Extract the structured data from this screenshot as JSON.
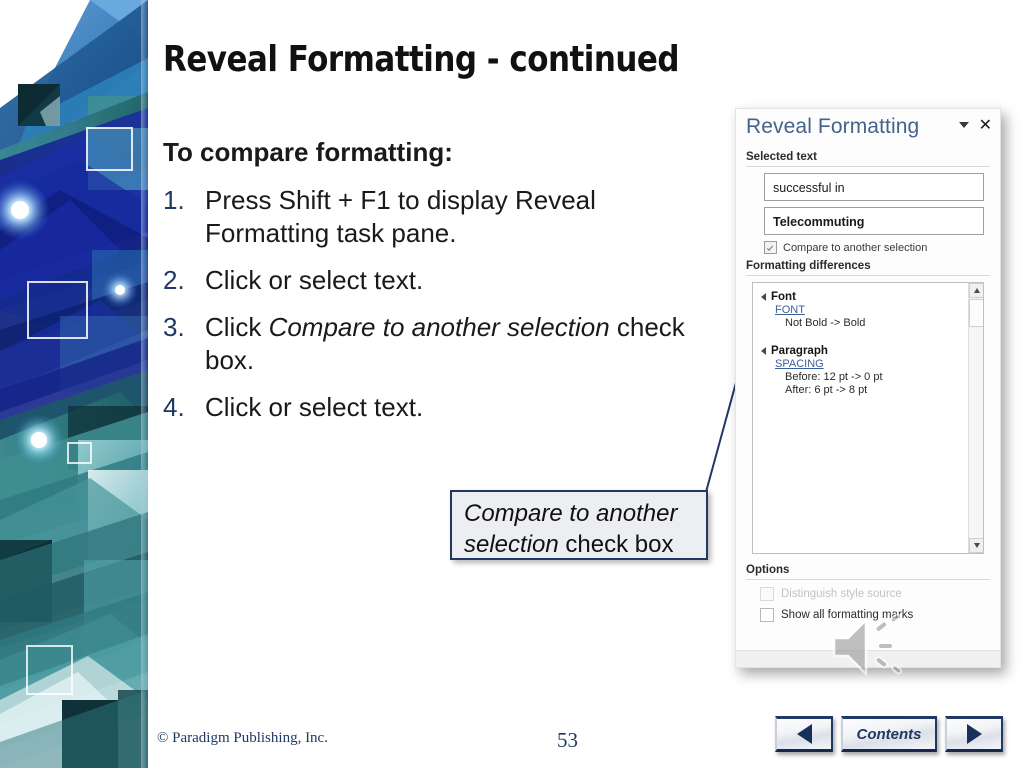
{
  "slide": {
    "title": "Reveal Formatting - continued",
    "lead": "To compare formatting:",
    "steps": [
      {
        "num": "1.",
        "pre": "Press Shift + F1 to display Reveal Formatting task pane.",
        "italic": "",
        "post": ""
      },
      {
        "num": "2.",
        "pre": "Click or select text.",
        "italic": "",
        "post": ""
      },
      {
        "num": "3.",
        "pre": "Click ",
        "italic": "Compare to another selection",
        "post": " check box."
      },
      {
        "num": "4.",
        "pre": "Click or select text.",
        "italic": "",
        "post": ""
      }
    ]
  },
  "callout": {
    "italic": "Compare to another selection",
    "post": " check box"
  },
  "pane": {
    "title": "Reveal Formatting",
    "collapse_icon": "chevron-down-icon",
    "close_icon": "close-icon",
    "selected_text_label": "Selected text",
    "selected_boxes": [
      {
        "value": "successful in",
        "bold": false
      },
      {
        "value": "Telecommuting",
        "bold": true
      }
    ],
    "compare_checkbox": {
      "label": "Compare to another selection",
      "checked": true
    },
    "differences_label": "Formatting differences",
    "differences": [
      {
        "group": "Font",
        "link": "FONT",
        "values": [
          "Not Bold -> Bold"
        ]
      },
      {
        "group": "Paragraph",
        "link": "SPACING",
        "values": [
          "Before:  12 pt ->  0 pt",
          "After:  6 pt ->  8 pt"
        ]
      }
    ],
    "scrollbar": {
      "up_icon": "scroll-up-arrow-icon",
      "down_icon": "scroll-down-arrow-icon"
    },
    "options_label": "Options",
    "options": [
      {
        "label": "Distinguish style source",
        "checked": false,
        "disabled": true
      },
      {
        "label": "Show all formatting marks",
        "checked": false,
        "disabled": false
      }
    ]
  },
  "media": {
    "speaker_icon": "speaker-audio-icon"
  },
  "footer": {
    "copyright": "© Paradigm Publishing, Inc.",
    "page_number": "53"
  },
  "nav": {
    "prev_icon": "previous-arrow-icon",
    "contents_label": "Contents",
    "next_icon": "next-arrow-icon"
  },
  "colors": {
    "accent_navy": "#1F3864",
    "pane_title": "#44628A",
    "link": "#3B5F9E"
  }
}
